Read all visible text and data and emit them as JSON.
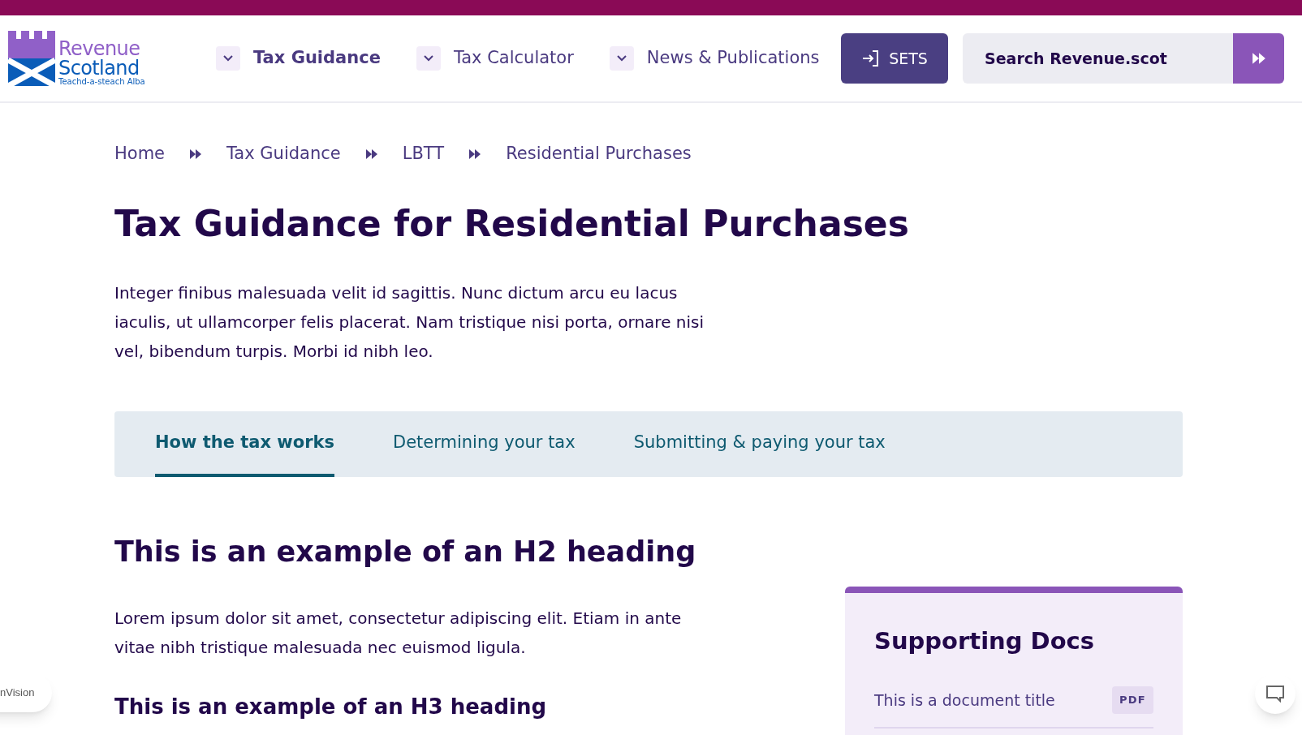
{
  "logo": {
    "line1": "Revenue",
    "line2": "Scotland",
    "tagline": "Teachd-a-steach Alba"
  },
  "nav": [
    {
      "label": "Tax Guidance",
      "selected": true
    },
    {
      "label": "Tax Calculator",
      "selected": false
    },
    {
      "label": "News & Publications",
      "selected": false
    }
  ],
  "sets_button": "SETS",
  "search": {
    "placeholder": "Search Revenue.scot"
  },
  "breadcrumbs": [
    "Home",
    "Tax Guidance",
    "LBTT",
    "Residential Purchases"
  ],
  "title": "Tax Guidance for Residential Purchases",
  "intro": "Integer finibus malesuada velit id sagittis. Nunc dictum arcu eu lacus iaculis, ut ullamcorper felis placerat. Nam tristique nisi porta, ornare nisi vel, bibendum turpis. Morbi id nibh leo.",
  "tabs": [
    {
      "label": "How the tax works",
      "selected": true
    },
    {
      "label": "Determining your tax",
      "selected": false
    },
    {
      "label": "Submitting & paying your tax",
      "selected": false
    }
  ],
  "h2": "This is an example of an H2 heading",
  "body": "Lorem ipsum dolor sit amet, consectetur adipiscing elit. Etiam in ante vitae nibh tristique malesuada nec euismod ligula.",
  "h3": "This is an example of an H3 heading",
  "supporting_docs": {
    "title": "Supporting Docs",
    "documents": [
      {
        "title": "This is a document title",
        "type": "PDF"
      }
    ]
  },
  "floating_badge": "nVision"
}
